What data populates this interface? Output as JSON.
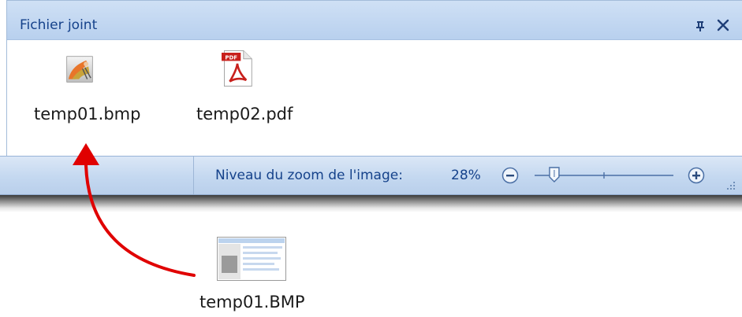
{
  "panel": {
    "title": "Fichier joint",
    "attachments": [
      {
        "name": "temp01.bmp",
        "icon": "bitmap-image-icon"
      },
      {
        "name": "temp02.pdf",
        "icon": "pdf-file-icon",
        "badge": "PDF"
      }
    ],
    "pin_icon": "pin-icon",
    "close_icon": "close-icon"
  },
  "statusbar": {
    "zoom_label": "Niveau du zoom de l'image:",
    "zoom_value": "28%",
    "zoom_level_percent": 28,
    "zoom_out_icon": "minus-circle-icon",
    "zoom_in_icon": "plus-circle-icon"
  },
  "dragged_file": {
    "name": "temp01.BMP",
    "icon": "screenshot-thumbnail-icon"
  },
  "colors": {
    "header_text": "#15428b",
    "arrow": "#e00000"
  }
}
